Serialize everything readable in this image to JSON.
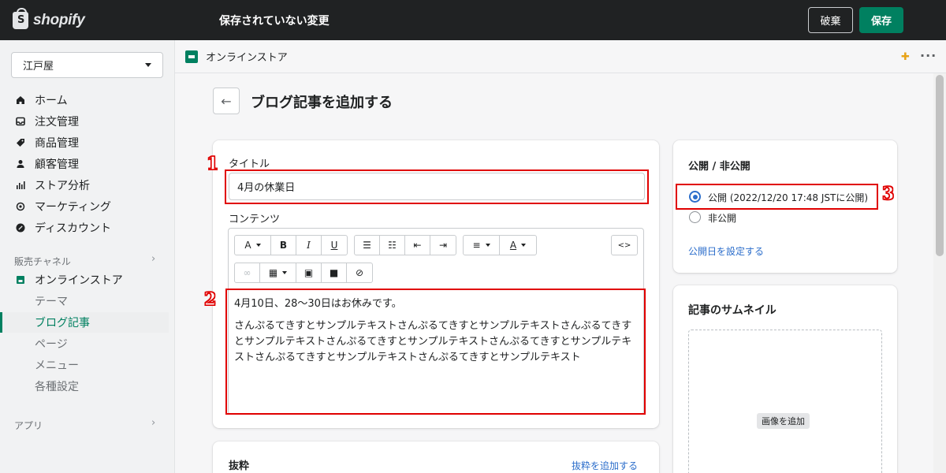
{
  "topbar": {
    "brand": "shopify",
    "title": "保存されていない変更",
    "discard_label": "破棄",
    "save_label": "保存",
    "brand_color": "#008060"
  },
  "sidebar": {
    "store": "江戸屋",
    "nav": [
      {
        "label": "ホーム",
        "icon": "home-icon"
      },
      {
        "label": "注文管理",
        "icon": "inbox-icon"
      },
      {
        "label": "商品管理",
        "icon": "tag-icon"
      },
      {
        "label": "顧客管理",
        "icon": "person-icon"
      },
      {
        "label": "ストア分析",
        "icon": "bar-chart-icon"
      },
      {
        "label": "マーケティング",
        "icon": "target-icon"
      },
      {
        "label": "ディスカウント",
        "icon": "discount-icon"
      }
    ],
    "sales_channel_label": "販売チャネル",
    "online_store": "オンラインストア",
    "sub_items": [
      "テーマ",
      "ブログ記事",
      "ページ",
      "メニュー",
      "各種設定"
    ],
    "apps_label": "アプリ"
  },
  "breadcrumb": {
    "label": "オンラインストア"
  },
  "page": {
    "title": "ブログ記事を追加する"
  },
  "editor_card": {
    "title_label": "タイトル",
    "title_value": "4月の休業日",
    "content_label": "コンテンツ",
    "toolbar": {
      "font": "A",
      "bold": "B",
      "italic": "I",
      "underline": "U",
      "code": "<>"
    },
    "content_line1": "4月10日、28〜30日はお休みです。",
    "content_para": "さんぷるてきすとサンプルテキストさんぷるてきすとサンプルテキストさんぷるてきすとサンプルテキストさんぷるてきすとサンプルテキストさんぷるてきすとサンプルテキストさんぷるてきすとサンプルテキストさんぷるてきすとサンプルテキスト"
  },
  "excerpt_card": {
    "title": "抜粋",
    "add_link": "抜粋を追加する"
  },
  "visibility_card": {
    "title": "公開 / 非公開",
    "option_public": "公開 (2022/12/20 17:48 JSTに公開)",
    "option_hidden": "非公開",
    "selected": "public",
    "set_date_link": "公開日を設定する"
  },
  "thumbnail_card": {
    "title": "記事のサムネイル",
    "add_image": "画像を追加"
  },
  "annotations": {
    "n1": "1",
    "n2": "2",
    "n3": "3",
    "color": "#e00000"
  }
}
